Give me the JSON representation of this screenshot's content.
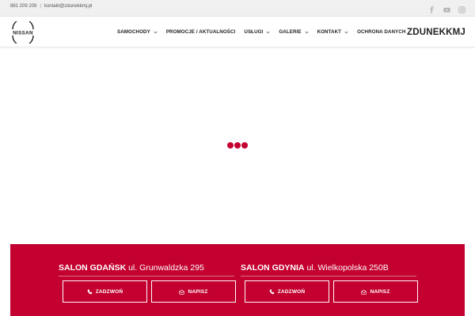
{
  "topbar": {
    "phone": "881 209 209",
    "email": "kontakt@zdunekkmj.pl",
    "social_icons": [
      "facebook-icon",
      "youtube-icon",
      "instagram-icon"
    ]
  },
  "header": {
    "logo_text": "NISSAN",
    "brand": "ZDUNEKKMJ",
    "nav": [
      {
        "label": "SAMOCHODY",
        "dropdown": true
      },
      {
        "label": "PROMOCJE / AKTUALNOŚCI",
        "dropdown": false
      },
      {
        "label": "USŁUGI",
        "dropdown": true
      },
      {
        "label": "GALERIE",
        "dropdown": true
      },
      {
        "label": "KONTAKT",
        "dropdown": true
      },
      {
        "label": "OCHRONA DANYCH",
        "dropdown": false
      }
    ]
  },
  "loader": {
    "color": "#c3002f"
  },
  "salons": [
    {
      "name": "SALON GDAŃSK",
      "address": "ul. Grunwaldzka 295",
      "call_label": "ZADZWOŃ",
      "write_label": "NAPISZ"
    },
    {
      "name": "SALON GDYNIA",
      "address": "ul. Wielkopolska 250B",
      "call_label": "ZADZWOŃ",
      "write_label": "NAPISZ"
    }
  ],
  "colors": {
    "accent": "#c3002f",
    "topbar_bg": "#f0f0f0",
    "text": "#222222"
  }
}
